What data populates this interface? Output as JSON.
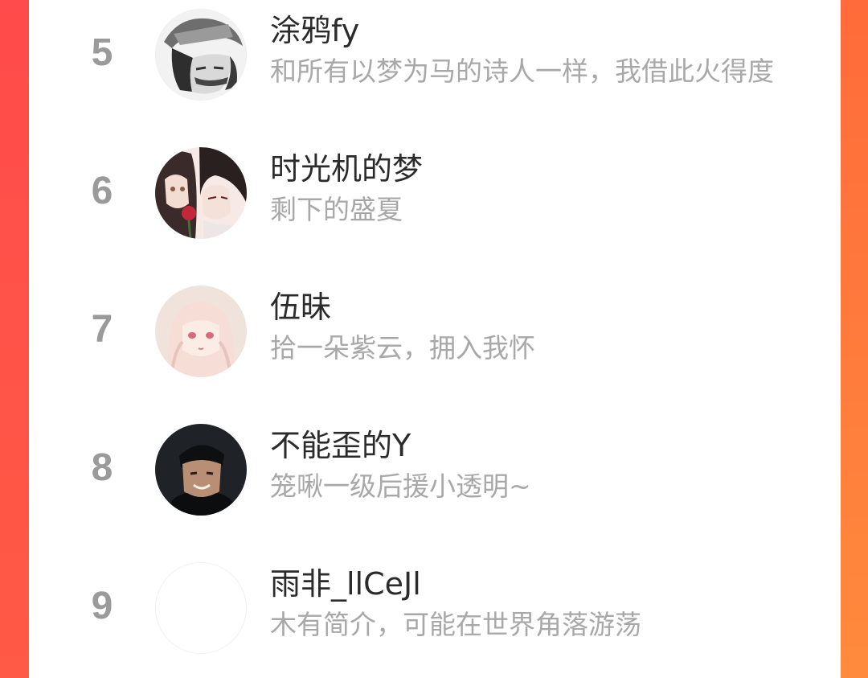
{
  "theme": {
    "accent_left": "#ff4b4b",
    "accent_right": "#ff7a3d",
    "rank_color": "#9a9a9a",
    "name_color": "#2b2b2b",
    "bio_color": "#a8a8a8"
  },
  "rank_list": {
    "items": [
      {
        "rank": "5",
        "name": "涂鸦fy",
        "bio": "和所有以梦为马的诗人一样，我借此火得度",
        "avatar": "anime-boy-sketch-avatar"
      },
      {
        "rank": "6",
        "name": "时光机的梦",
        "bio": "剩下的盛夏",
        "avatar": "anime-couple-rose-avatar"
      },
      {
        "rank": "7",
        "name": "伍昧",
        "bio": "拾一朵紫云，拥入我怀",
        "avatar": "anime-pale-girl-avatar"
      },
      {
        "rank": "8",
        "name": "不能歪的Y",
        "bio": "笼啾一级后援小透明~",
        "avatar": "photo-boy-dark-avatar"
      },
      {
        "rank": "9",
        "name": "雨非_llCeJl",
        "bio": "木有简介，可能在世界角落游荡",
        "avatar": "blank-avatar"
      }
    ]
  }
}
